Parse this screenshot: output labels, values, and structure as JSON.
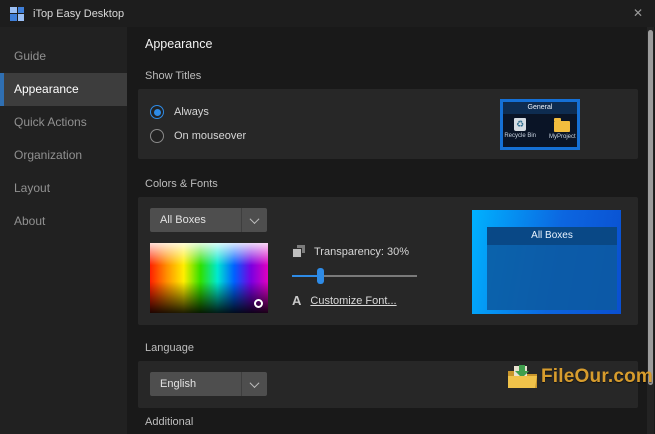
{
  "window": {
    "title": "iTop Easy Desktop",
    "close_icon": "✕"
  },
  "colors": {
    "accent_blue": "#2e8be6",
    "sidebar_accent": "#2f6fb2",
    "panel_bg": "#272727",
    "preview_border_blue": "#1570d6",
    "preview_gradient_start": "#00b2ff",
    "preview_gradient_end": "#0a4fd0",
    "folder_yellow": "#f2bd3e",
    "watermark_gold": "#d79c2d"
  },
  "icons": {
    "recycle_glyph": "♻"
  },
  "sidebar": {
    "items": [
      {
        "label": "Guide",
        "selected": false
      },
      {
        "label": "Appearance",
        "selected": true
      },
      {
        "label": "Quick Actions",
        "selected": false
      },
      {
        "label": "Organization",
        "selected": false
      },
      {
        "label": "Layout",
        "selected": false
      },
      {
        "label": "About",
        "selected": false
      }
    ]
  },
  "main": {
    "heading": "Appearance",
    "show_titles": {
      "label": "Show Titles",
      "options": [
        {
          "label": "Always",
          "selected": true
        },
        {
          "label": "On mouseover",
          "selected": false
        }
      ],
      "preview": {
        "title": "General",
        "items": [
          {
            "label": "Recycle Bin"
          },
          {
            "label": "MyProject"
          }
        ]
      }
    },
    "colors_fonts": {
      "label": "Colors & Fonts",
      "target_selector": {
        "value": "All Boxes"
      },
      "transparency": {
        "label": "Transparency: 30%",
        "percent": 30
      },
      "customize_font": {
        "icon_letter": "A",
        "label": "Customize Font..."
      },
      "preview": {
        "title": "All Boxes"
      }
    },
    "language": {
      "label": "Language",
      "selector": {
        "value": "English"
      }
    },
    "additional": {
      "label": "Additional"
    }
  },
  "watermark": {
    "text": "FileOur.com"
  }
}
